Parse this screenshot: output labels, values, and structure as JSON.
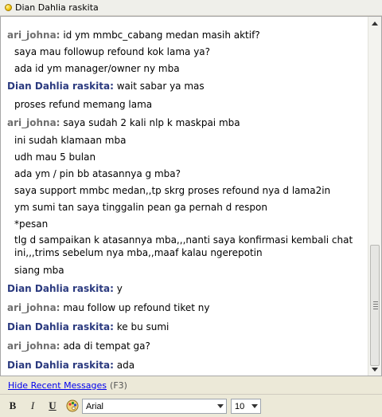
{
  "window": {
    "title": "Dian Dahlia raskita"
  },
  "messages": [
    {
      "sender": "ari_johna",
      "side": "ari",
      "lines": [
        "id ym mmbc_cabang medan masih aktif?",
        "saya mau followup refound kok lama ya?",
        "ada id ym manager/owner ny mba"
      ]
    },
    {
      "sender": "Dian Dahlia raskita",
      "side": "dian",
      "lines": [
        "wait sabar ya mas",
        "proses refund memang lama"
      ]
    },
    {
      "sender": "ari_johna",
      "side": "ari",
      "lines": [
        "saya sudah 2 kali nlp k maskpai mba",
        "ini sudah klamaan mba",
        "udh mau 5 bulan",
        "ada ym / pin bb atasannya g mba?",
        "saya support mmbc medan,,tp skrg proses refound nya d lama2in",
        "ym sumi tan saya tinggalin pean ga pernah d respon",
        "*pesan",
        "tlg d sampaikan k atasannya mba,,,nanti saya konfirmasi kembali chat ini,,,trims sebelum nya mba,,maaf kalau ngerepotin",
        "siang mba"
      ]
    },
    {
      "sender": "Dian Dahlia raskita",
      "side": "dian",
      "lines": [
        "y"
      ]
    },
    {
      "sender": "ari_johna",
      "side": "ari",
      "lines": [
        "mau follow up refound tiket ny"
      ]
    },
    {
      "sender": "Dian Dahlia raskita",
      "side": "dian",
      "lines": [
        "ke bu sumi"
      ]
    },
    {
      "sender": "ari_johna",
      "side": "ari",
      "lines": [
        "ada di tempat ga?"
      ]
    },
    {
      "sender": "Dian Dahlia raskita",
      "side": "dian",
      "lines": [
        "ada"
      ]
    }
  ],
  "bottom": {
    "hide_link": "Hide Recent Messages",
    "shortcut": "(F3)"
  },
  "format_toolbar": {
    "bold": "B",
    "italic": "I",
    "underline": "U",
    "font_family_value": "Arial",
    "font_size_value": "10"
  },
  "colors": {
    "dian_sender": "#2b3a7f",
    "ari_sender": "#6e6e6e",
    "link": "#0000ee"
  }
}
